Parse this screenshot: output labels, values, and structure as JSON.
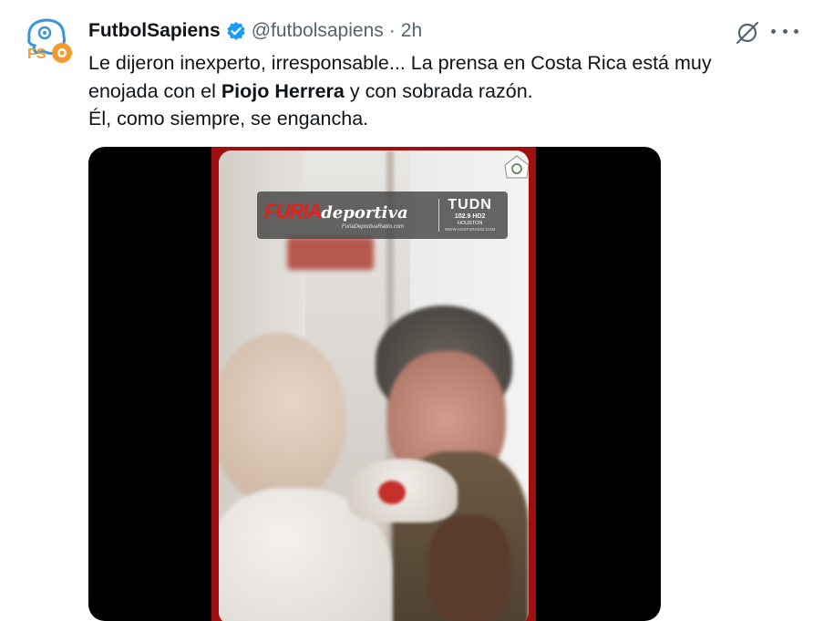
{
  "author": {
    "display_name": "FutbolSapiens",
    "handle": "@futbolsapiens",
    "separator": "·",
    "time": "2h",
    "avatar_letters": "FS"
  },
  "tweet": {
    "line1": "Le dijeron inexperto, irresponsable... La prensa en Costa Rica está muy",
    "line2_start": "enojada con el ",
    "line2_bold": "Piojo Herrera",
    "line2_end": " y con sobrada razón.",
    "line3": "Él, como siempre, se engancha."
  },
  "media": {
    "overlay_brand_red": "FURIA",
    "overlay_brand_white": "deportiva",
    "overlay_brand_site": "FuriaDeportivaRadio.com",
    "overlay_station": "TUDN",
    "overlay_frequency": "102.9 HD2",
    "overlay_city": "HOUSTON",
    "overlay_station_site": "WWW.HOSTVRADIO.COM"
  },
  "colors": {
    "verified": "#1d9bf0",
    "text": "#0f1419",
    "muted": "#536471",
    "video_border": "#a01010"
  },
  "icons": {
    "verified": "verified-badge-icon",
    "grok": "grok-icon",
    "more": "more-icon"
  }
}
